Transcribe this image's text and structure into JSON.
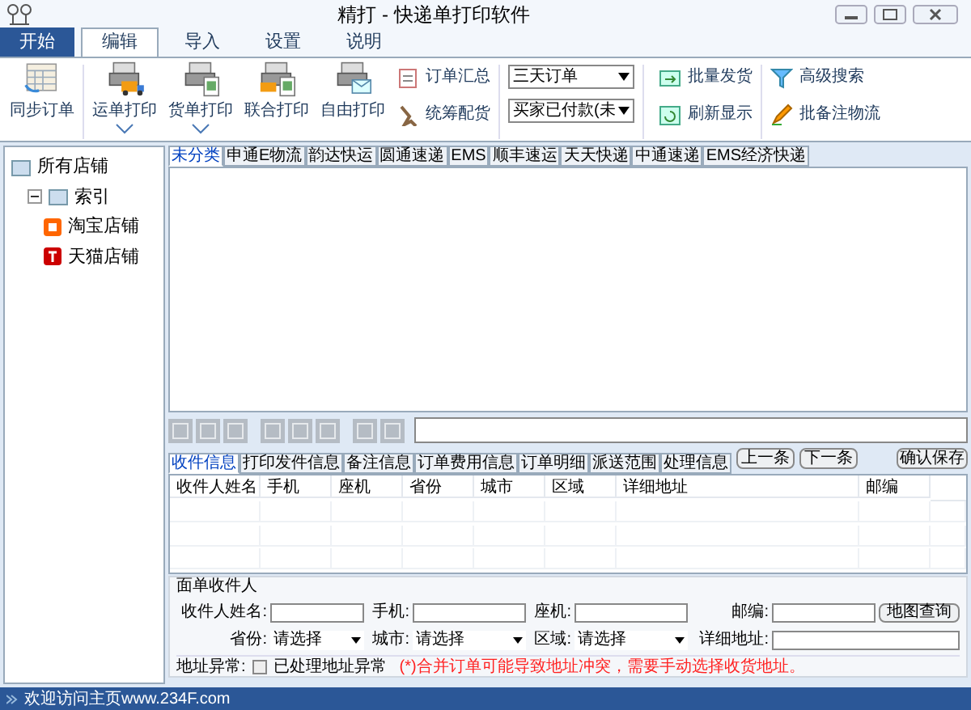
{
  "window": {
    "title": "精打 - 快递单打印软件"
  },
  "menu_tabs": [
    {
      "label": "开始",
      "kind": "start",
      "selected": false
    },
    {
      "label": "编辑",
      "kind": "tab",
      "selected": true
    },
    {
      "label": "导入",
      "kind": "tab",
      "selected": false
    },
    {
      "label": "设置",
      "kind": "tab",
      "selected": false
    },
    {
      "label": "说明",
      "kind": "tab",
      "selected": false
    }
  ],
  "ribbon": {
    "big_buttons": [
      {
        "label": "同步订单",
        "kind": "sync",
        "dropdown": false
      },
      {
        "label": "运单打印",
        "kind": "truck",
        "dropdown": true
      },
      {
        "label": "货单打印",
        "kind": "sheet",
        "dropdown": true
      },
      {
        "label": "联合打印",
        "kind": "combo",
        "dropdown": false
      },
      {
        "label": "自由打印",
        "kind": "mail",
        "dropdown": false
      }
    ],
    "small_buttons": [
      {
        "label": "订单汇总",
        "kind": "clipboard"
      },
      {
        "label": "统筹配货",
        "kind": "tool"
      }
    ],
    "selects": [
      {
        "value": "三天订单"
      },
      {
        "value": "买家已付款(未"
      }
    ],
    "links_1": [
      {
        "label": "批量发货",
        "kind": "ship"
      },
      {
        "label": "刷新显示",
        "kind": "refresh"
      }
    ],
    "links_2": [
      {
        "label": "高级搜索",
        "kind": "filter"
      },
      {
        "label": "批备注物流",
        "kind": "pen"
      }
    ]
  },
  "tree": {
    "label": "所有店铺",
    "children": [
      {
        "label": "索引",
        "expanded": true,
        "children": [
          {
            "label": "淘宝店铺",
            "kind": "taobao"
          },
          {
            "label": "天猫店铺",
            "kind": "tmall"
          }
        ]
      }
    ]
  },
  "courier_tabs": [
    {
      "label": "未分类",
      "selected": true
    },
    {
      "label": "申通E物流",
      "selected": false
    },
    {
      "label": "韵达快运",
      "selected": false
    },
    {
      "label": "圆通速递",
      "selected": false
    },
    {
      "label": "EMS",
      "selected": false
    },
    {
      "label": "顺丰速运",
      "selected": false
    },
    {
      "label": "天天快递",
      "selected": false
    },
    {
      "label": "中通速递",
      "selected": false
    },
    {
      "label": "EMS经济快递",
      "selected": false
    }
  ],
  "detail_tabs": [
    {
      "label": "收件信息",
      "selected": true
    },
    {
      "label": "打印发件信息",
      "selected": false
    },
    {
      "label": "备注信息",
      "selected": false
    },
    {
      "label": "订单费用信息",
      "selected": false
    },
    {
      "label": "订单明细",
      "selected": false
    },
    {
      "label": "派送范围",
      "selected": false
    },
    {
      "label": "处理信息",
      "selected": false
    }
  ],
  "nav_buttons": [
    "上一条",
    "下一条"
  ],
  "save_button": "确认保存",
  "table": {
    "columns": [
      "收件人姓名",
      "手机",
      "座机",
      "省份",
      "城市",
      "区域",
      "详细地址",
      "邮编"
    ]
  },
  "form": {
    "title": "面单收件人",
    "fields": [
      {
        "label": "收件人姓名:",
        "kind": "input"
      },
      {
        "label": "手机:",
        "kind": "input"
      },
      {
        "label": "座机:",
        "kind": "input"
      },
      {
        "label": "邮编:",
        "kind": "input"
      },
      {
        "label": "省份:",
        "kind": "select",
        "value": "请选择"
      },
      {
        "label": "城市:",
        "kind": "select",
        "value": "请选择"
      },
      {
        "label": "区域:",
        "kind": "select",
        "value": "请选择"
      },
      {
        "label": "详细地址:",
        "kind": "input"
      }
    ],
    "map_button": "地图查询"
  },
  "address_issue": {
    "label": "地址异常:",
    "checkbox_label": "已处理地址异常",
    "checked": false,
    "warning": "(*)合并订单可能导致地址冲突，需要手动选择收货地址。"
  },
  "status_bar": "欢迎访问主页www.234F.com"
}
